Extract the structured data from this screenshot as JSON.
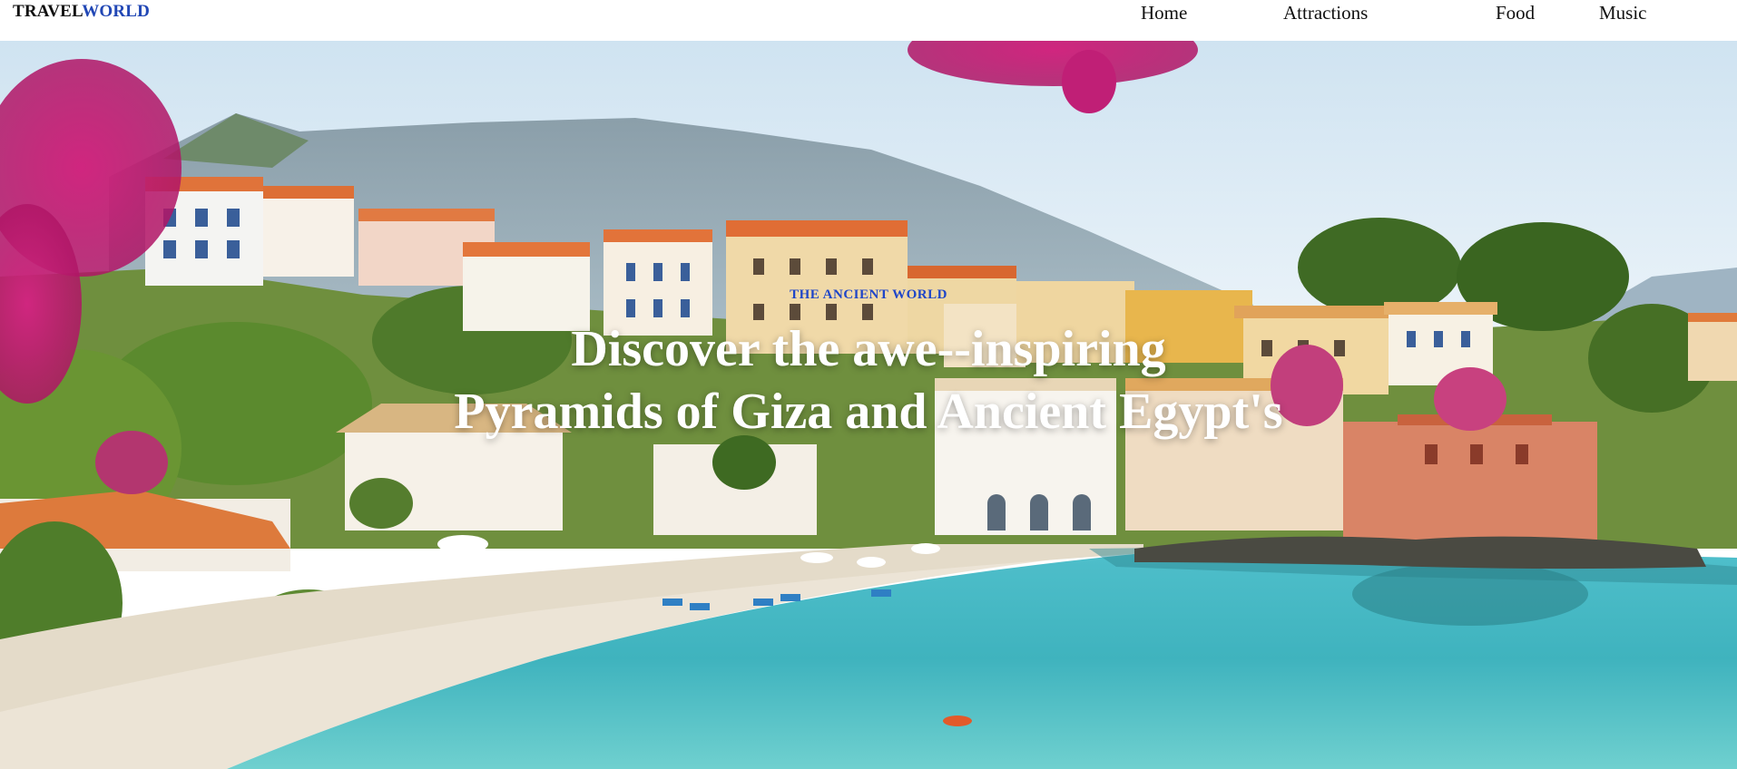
{
  "brand": {
    "part1": "TRAVEL",
    "part2": "WORLD"
  },
  "nav": {
    "items": [
      {
        "label": "Home"
      },
      {
        "label": "Attractions"
      },
      {
        "label": "Food"
      },
      {
        "label": "Music"
      }
    ]
  },
  "hero": {
    "eyebrow": "THE ANCIENT WORLD",
    "headline_line1": "Discover the awe--inspiring",
    "headline_line2": "Pyramids of Giza and Ancient Egypt's",
    "background": "coastal village with colorful houses, beach and turquoise sea, flowers in foreground"
  },
  "colors": {
    "brand_dark": "#111111",
    "brand_accent": "#2147b5",
    "eyebrow": "#1f46c8",
    "headline": "#ffffff",
    "sea": "#3fb8c4",
    "roof": "#e0733a"
  }
}
